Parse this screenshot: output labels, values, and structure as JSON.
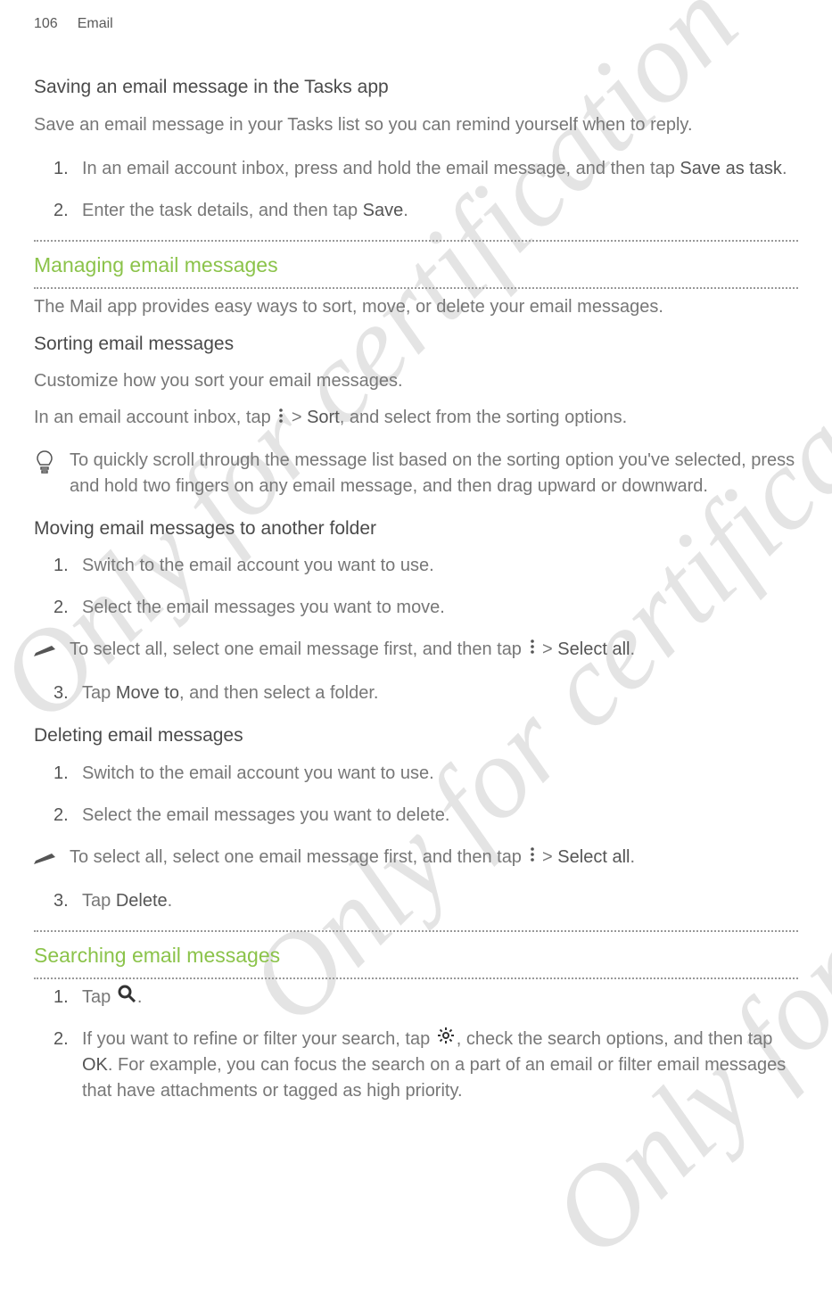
{
  "page_number": "106",
  "section_name": "Email",
  "heading1": "Saving an email message in the Tasks app",
  "intro1": "Save an email message in your Tasks list so you can remind yourself when to reply.",
  "list1": {
    "item1_pre": "In an email account inbox, press and hold the email message, and then tap ",
    "item1_bold": "Save as task",
    "item1_post": ".",
    "item2_pre": "Enter the task details, and then tap ",
    "item2_bold": "Save",
    "item2_post": "."
  },
  "heading2": "Managing email messages",
  "intro2": "The Mail app provides easy ways to sort, move, or delete your email messages.",
  "sub2a": "Sorting email messages",
  "body2a1": "Customize how you sort your email messages.",
  "body2a2_pre": "In an email account inbox, tap ",
  "body2a2_mid": " > ",
  "body2a2_bold": "Sort",
  "body2a2_post": ", and select from the sorting options.",
  "tip1": "To quickly scroll through the message list based on the sorting option you've selected, press and hold two fingers on any email message, and then drag upward or downward.",
  "sub2b": "Moving email messages to another folder",
  "list2b": {
    "item1": "Switch to the email account you want to use.",
    "item2": "Select the email messages you want to move."
  },
  "tip2_pre": "To select all, select one email message first, and then tap ",
  "tip2_mid": " > ",
  "tip2_bold": "Select all",
  "tip2_post": ".",
  "list2b_cont": {
    "item3_pre": "Tap ",
    "item3_bold": "Move to",
    "item3_post": ", and then select a folder."
  },
  "sub2c": "Deleting email messages",
  "list2c": {
    "item1": "Switch to the email account you want to use.",
    "item2": "Select the email messages you want to delete."
  },
  "tip3_pre": "To select all, select one email message first, and then tap ",
  "tip3_mid": " > ",
  "tip3_bold": "Select all",
  "tip3_post": ".",
  "list2c_cont": {
    "item3_pre": "Tap ",
    "item3_bold": "Delete",
    "item3_post": "."
  },
  "heading3": "Searching email messages",
  "list3": {
    "item1_pre": "Tap ",
    "item1_post": ".",
    "item2_pre": "If you want to refine or filter your search, tap ",
    "item2_mid": ", check the search options, and then tap ",
    "item2_bold": "OK",
    "item2_post": ". For example, you can focus the search on a part of an email or filter email messages that have attachments or tagged as high priority."
  },
  "watermark": "Only for certification"
}
